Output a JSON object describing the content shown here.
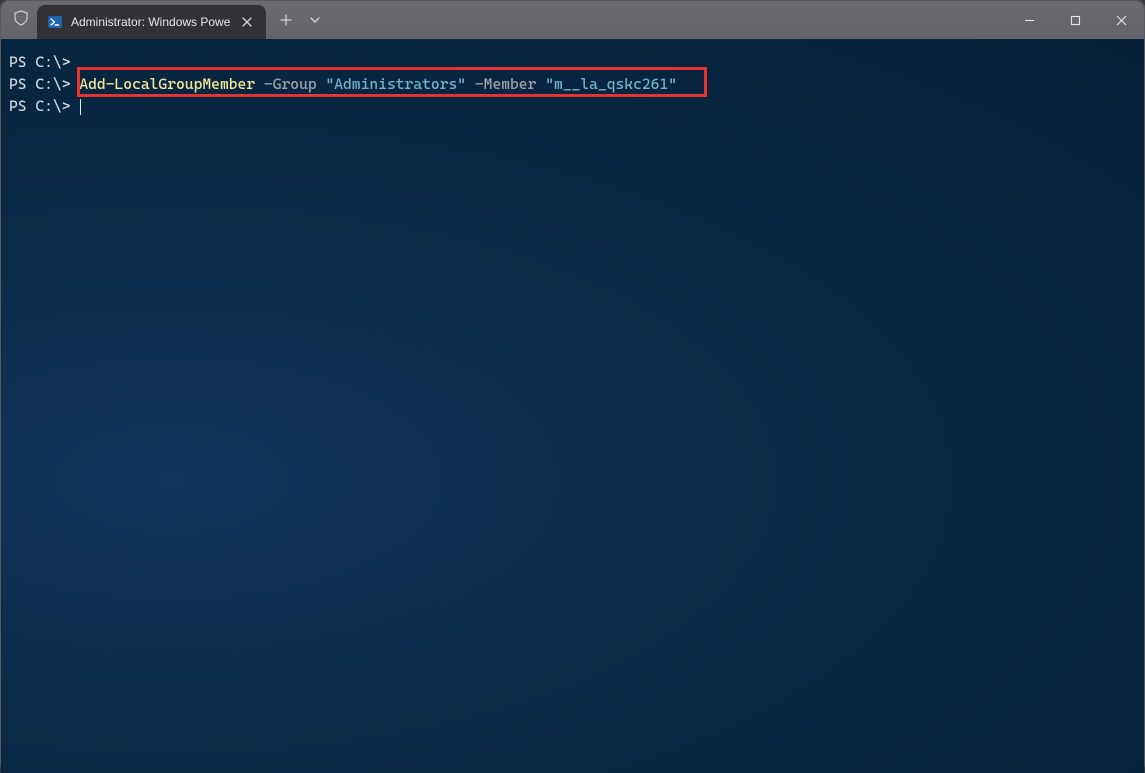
{
  "window": {
    "tab": {
      "title": "Administrator: Windows Powe"
    }
  },
  "terminal": {
    "lines": [
      {
        "prompt": "PS C:\\>",
        "body": ""
      },
      {
        "prompt": "PS C:\\>",
        "cmd": "Add-LocalGroupMember",
        "p1": "-Group",
        "s1": "\"Administrators\"",
        "p2": "-Member",
        "s2": "\"m__la_qskc261\""
      },
      {
        "prompt": "PS C:\\>",
        "body": ""
      }
    ]
  }
}
